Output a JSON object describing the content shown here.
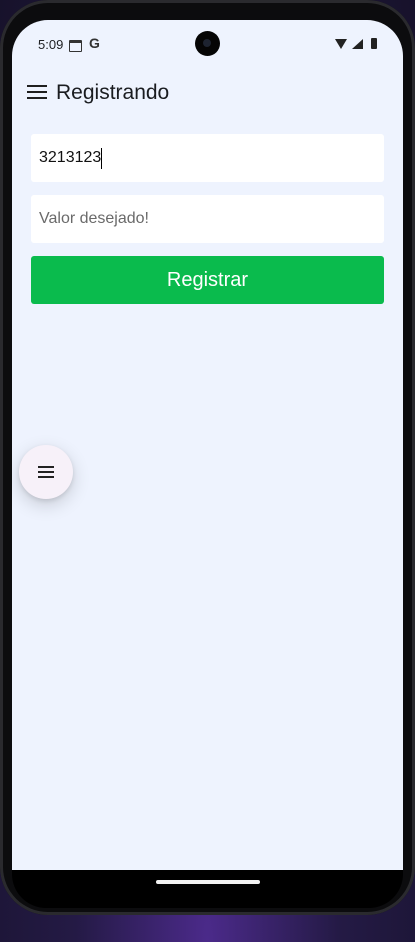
{
  "status_bar": {
    "time": "5:09",
    "icons": [
      "calendar-icon",
      "google-icon",
      "wifi-icon",
      "signal-icon",
      "battery-icon"
    ],
    "google_glyph": "G"
  },
  "app_bar": {
    "title": "Registrando",
    "menu_icon": "menu-icon"
  },
  "form": {
    "amount_field": {
      "value": "3213123",
      "placeholder": ""
    },
    "value_field": {
      "value": "",
      "placeholder": "Valor desejado!"
    },
    "register_label": "Registrar"
  },
  "fab": {
    "icon": "menu-icon"
  },
  "colors": {
    "background": "#eef3fe",
    "button": "#0abb4d",
    "button_text": "#ffffff",
    "fab": "#f7f1f9"
  }
}
